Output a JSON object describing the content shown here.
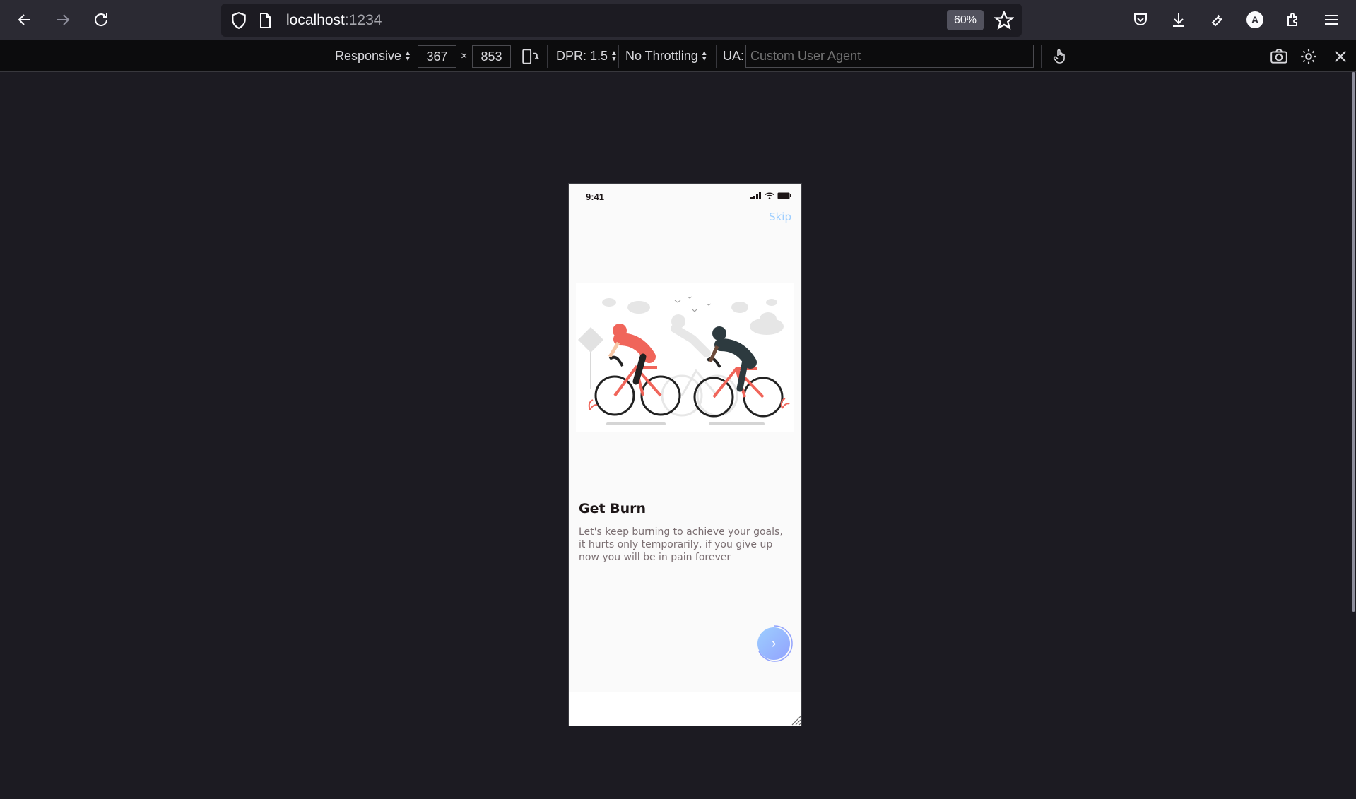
{
  "browser": {
    "url_host": "localhost",
    "url_port": ":1234",
    "zoom": "60%",
    "profile_initial": "A"
  },
  "rdm": {
    "device": "Responsive",
    "width": "367",
    "times": "×",
    "height": "853",
    "dpr": "DPR: 1.5",
    "throttling": "No Throttling",
    "ua_label": "UA:",
    "ua_placeholder": "Custom User Agent"
  },
  "app": {
    "status_time": "9:41",
    "skip_label": "Skip",
    "title": "Get Burn",
    "description": "Let's keep burning to achieve your goals, it hurts only temporarily, if you give up now you will be in pain forever",
    "next_symbol": "›",
    "colors": {
      "accent_start": "#9DCEFF",
      "accent_end": "#92A3FD",
      "title": "#1D1617",
      "body": "#7B6F72"
    }
  }
}
